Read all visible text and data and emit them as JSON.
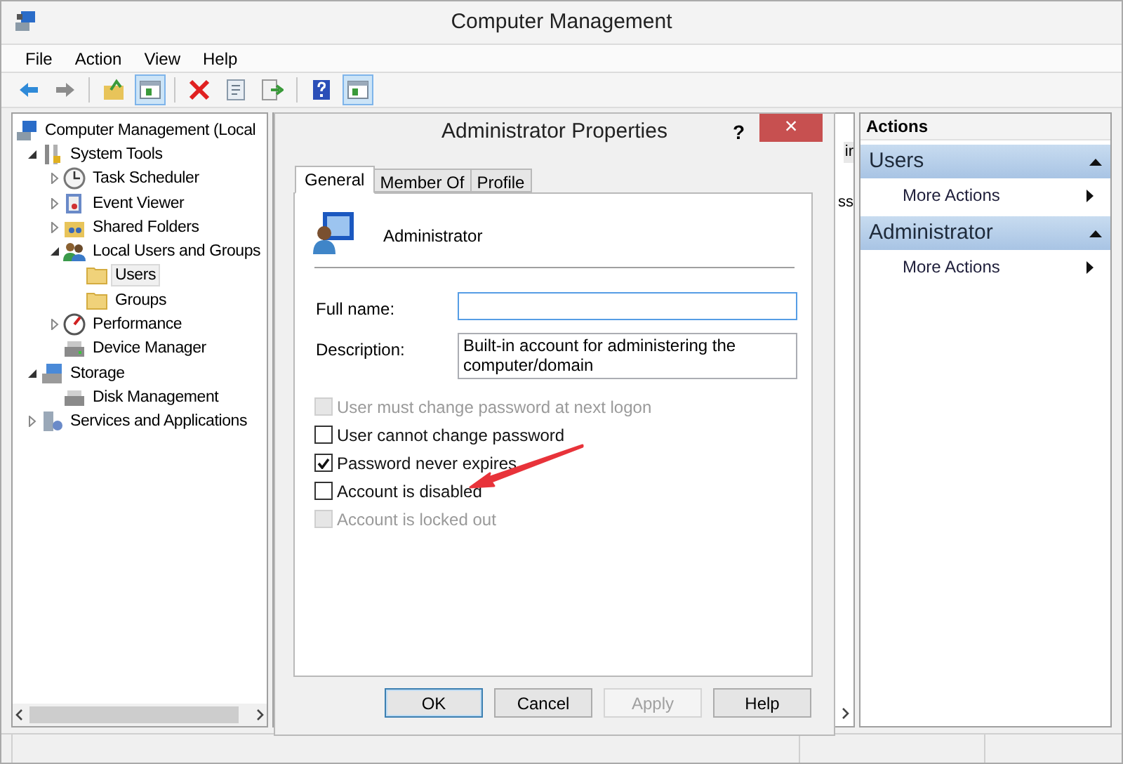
{
  "window": {
    "title": "Computer Management"
  },
  "menu": [
    "File",
    "Action",
    "View",
    "Help"
  ],
  "toolbar": [
    [
      {
        "kind": "back",
        "pressed": false
      },
      {
        "kind": "forward",
        "pressed": false
      }
    ],
    [
      {
        "kind": "up",
        "pressed": false
      },
      {
        "kind": "tree",
        "pressed": true
      }
    ],
    [
      {
        "kind": "delete",
        "pressed": false
      },
      {
        "kind": "properties",
        "pressed": false
      },
      {
        "kind": "export",
        "pressed": false
      }
    ],
    [
      {
        "kind": "help",
        "pressed": false
      },
      {
        "kind": "pane",
        "pressed": true
      }
    ]
  ],
  "tree": [
    {
      "label": "Computer Management (Local",
      "kind": "computer",
      "selected": false,
      "children": [
        {
          "label": "System Tools",
          "kind": "tools",
          "expanded": true,
          "selected": false,
          "children": [
            {
              "label": "Task Scheduler",
              "kind": "clock",
              "expanded": false,
              "selected": false
            },
            {
              "label": "Event Viewer",
              "kind": "log",
              "expanded": false,
              "selected": false
            },
            {
              "label": "Shared Folders",
              "kind": "share",
              "expanded": false,
              "selected": false
            },
            {
              "label": "Local Users and Groups",
              "kind": "users",
              "expanded": true,
              "selected": false,
              "children": [
                {
                  "label": "Users",
                  "kind": "folder",
                  "selected": true
                },
                {
                  "label": "Groups",
                  "kind": "folder",
                  "selected": false
                }
              ]
            },
            {
              "label": "Performance",
              "kind": "gauge",
              "expanded": false,
              "selected": false
            },
            {
              "label": "Device Manager",
              "kind": "device",
              "selected": false
            }
          ]
        },
        {
          "label": "Storage",
          "kind": "storage",
          "expanded": true,
          "selected": false,
          "children": [
            {
              "label": "Disk Management",
              "kind": "disk",
              "selected": false
            }
          ]
        },
        {
          "label": "Services and Applications",
          "kind": "services",
          "expanded": false,
          "selected": false
        }
      ]
    }
  ],
  "middle_pane": {
    "column_header": "ir",
    "cell": "ss"
  },
  "actions": {
    "title": "Actions",
    "sections": [
      {
        "title": "Users",
        "items": [
          "More Actions"
        ]
      },
      {
        "title": "Administrator",
        "items": [
          "More Actions"
        ]
      }
    ]
  },
  "dialog": {
    "title": "Administrator Properties",
    "help": "?",
    "close": "×",
    "tabs": [
      {
        "label": "General",
        "selected": true
      },
      {
        "label": "Member Of",
        "selected": false
      },
      {
        "label": "Profile",
        "selected": false
      }
    ],
    "user_name": "Administrator",
    "fields": [
      {
        "label": "Full name:",
        "focused": true
      },
      {
        "label": "Description:",
        "value": "Built-in account for administering the computer/domain",
        "focused": false
      }
    ],
    "checkboxes": [
      {
        "label": "User must change password at next logon",
        "checked": false,
        "disabled": true
      },
      {
        "label": "User cannot change password",
        "checked": false,
        "disabled": false
      },
      {
        "label": "Password never expires",
        "checked": true,
        "disabled": false
      },
      {
        "label": "Account is disabled",
        "checked": false,
        "disabled": false
      },
      {
        "label": "Account is locked out",
        "checked": false,
        "disabled": true
      }
    ],
    "buttons": [
      {
        "label": "OK",
        "default": true,
        "disabled": false
      },
      {
        "label": "Cancel",
        "default": false,
        "disabled": false
      },
      {
        "label": "Apply",
        "default": false,
        "disabled": true
      },
      {
        "label": "Help",
        "default": false,
        "disabled": false
      }
    ]
  }
}
